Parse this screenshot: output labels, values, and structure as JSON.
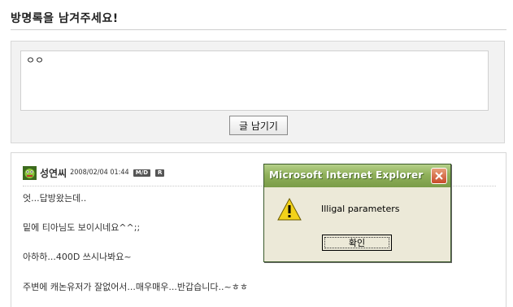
{
  "page": {
    "title": "방명록을 남겨주세요!"
  },
  "form": {
    "textarea_value": "ㅇㅇ",
    "submit_label": "글 남기기"
  },
  "entry": {
    "author": "성연씨",
    "date": "2008/02/04 01:44",
    "badge_modify": "M/D",
    "badge_reply": "R",
    "lines": [
      "엇...답방왔는데..",
      "밑에 티아님도 보이시네요^^;;",
      "아하하...400D 쓰시나봐요~",
      "주변에 캐논유저가 잘없어서...매우매우...반갑습니다..~ㅎㅎ"
    ]
  },
  "dialog": {
    "title": "Microsoft Internet Explorer",
    "message": "Illigal parameters",
    "ok_label": "확인"
  },
  "colors": {
    "dialog_title_bar": "#8fb05a",
    "dialog_background": "#ece9d8",
    "warning_icon": "#f2d21a"
  }
}
